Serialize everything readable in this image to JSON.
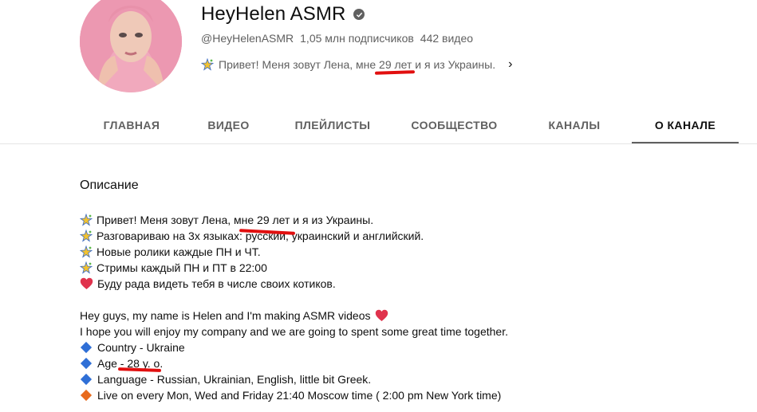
{
  "channel": {
    "name": "HeyHelen ASMR",
    "handle": "@HeyHelenASMR",
    "subscribers": "1,05 млн подписчиков",
    "videos": "442 видео",
    "description_preview": "Привет! Меня зовут Лена, мне 29 лет и я из Украины."
  },
  "tabs": [
    {
      "label": "ГЛАВНАЯ"
    },
    {
      "label": "ВИДЕО"
    },
    {
      "label": "ПЛЕЙЛИСТЫ"
    },
    {
      "label": "СООБЩЕСТВО"
    },
    {
      "label": "КАНАЛЫ"
    },
    {
      "label": "О КАНАЛЕ",
      "active": true
    }
  ],
  "about": {
    "section_title": "Описание",
    "lines": [
      "Привет! Меня зовут Лена, мне 29 лет и я из Украины.",
      "Разговариваю на 3х языках: русский, украинский и английский.",
      "Новые ролики каждые ПН и ЧТ.",
      "Стримы каждый ПН и ПТ в 22:00",
      "Буду рада видеть тебя в числе своих котиков.",
      "Hey guys, my name is Helen and I'm making ASMR videos",
      "I hope you will enjoy my company and we are going to spent some great time together.",
      "Country - Ukraine",
      "Age - 28 y. o.",
      "Language - Russian, Ukrainian, English, little bit Greek.",
      "Live on every Mon, Wed and Friday 21:40 Moscow time ( 2:00 pm New York time)"
    ]
  },
  "colors": {
    "text_primary": "#0f0f0f",
    "text_secondary": "#606060",
    "marker_red": "#e10f0f",
    "diamond_blue": "#2f6fd6",
    "diamond_orange": "#e86a1c",
    "heart_red": "#e0334d"
  }
}
